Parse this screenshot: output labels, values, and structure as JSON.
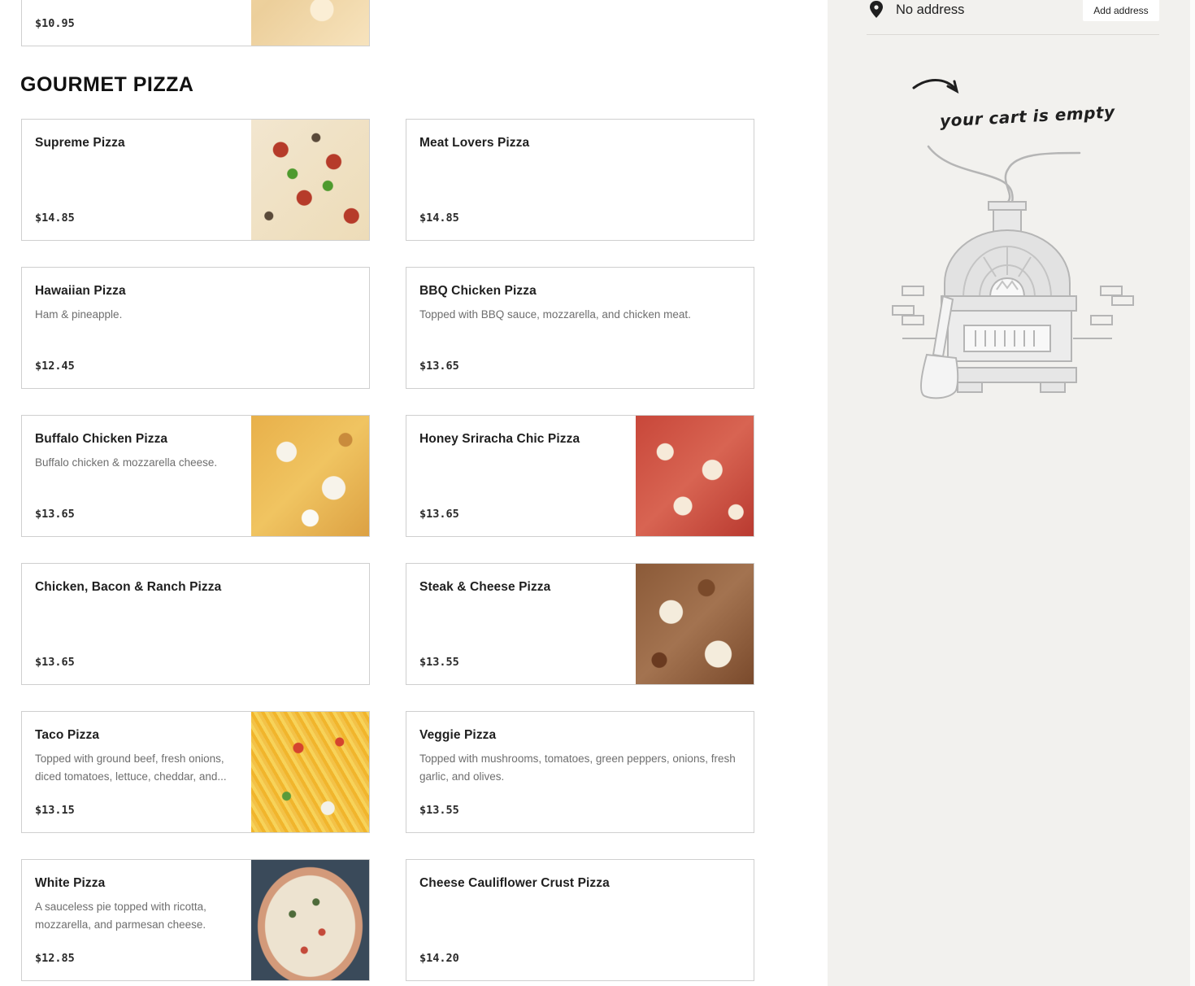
{
  "section": {
    "title": "GOURMET PIZZA"
  },
  "top_partial": {
    "price": "$10.95"
  },
  "items": [
    {
      "name": "Supreme Pizza",
      "desc": "",
      "price": "$14.85"
    },
    {
      "name": "Meat Lovers Pizza",
      "desc": "",
      "price": "$14.85"
    },
    {
      "name": "Hawaiian Pizza",
      "desc": "Ham & pineapple.",
      "price": "$12.45"
    },
    {
      "name": "BBQ Chicken Pizza",
      "desc": "Topped with BBQ sauce, mozzarella, and chicken meat.",
      "price": "$13.65"
    },
    {
      "name": "Buffalo Chicken Pizza",
      "desc": "Buffalo chicken & mozzarella cheese.",
      "price": "$13.65"
    },
    {
      "name": "Honey Sriracha Chic Pizza",
      "desc": "",
      "price": "$13.65"
    },
    {
      "name": "Chicken, Bacon & Ranch Pizza",
      "desc": "",
      "price": "$13.65"
    },
    {
      "name": "Steak & Cheese Pizza",
      "desc": "",
      "price": "$13.55"
    },
    {
      "name": "Taco Pizza",
      "desc": "Topped with ground beef, fresh onions, diced tomatoes, lettuce, cheddar, and...",
      "price": "$13.15"
    },
    {
      "name": "Veggie Pizza",
      "desc": "Topped with mushrooms, tomatoes, green peppers, onions, fresh garlic, and olives.",
      "price": "$13.55"
    },
    {
      "name": "White Pizza",
      "desc": "A sauceless pie topped with ricotta, mozzarella, and parmesan cheese.",
      "price": "$12.85"
    },
    {
      "name": "Cheese Cauliflower Crust Pizza",
      "desc": "",
      "price": "$14.20"
    }
  ],
  "sidebar": {
    "address_label": "No address",
    "add_address_button": "Add address",
    "cart_empty_text": "your cart is empty",
    "pin_icon": "location-pin-icon"
  },
  "colors": {
    "sidebar_bg": "#f2f1ee",
    "card_border": "#cfcfcf",
    "text_dark": "#1f1f1f",
    "text_muted": "#6e6e6e"
  }
}
